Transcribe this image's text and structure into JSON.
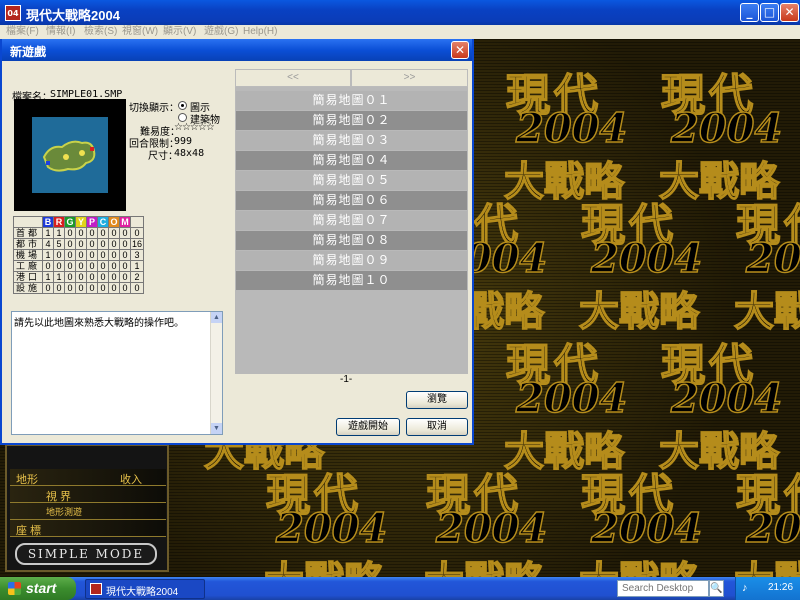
{
  "window": {
    "title": "現代大戰略2004",
    "app_icon_text": "04",
    "minimize": "_",
    "maximize": "□",
    "close": "✕"
  },
  "menu": [
    "檔案(F)",
    "情報(I)",
    "檢索(S)",
    "視窗(W)",
    "顯示(V)",
    "遊戲(G)",
    "Help(H)"
  ],
  "background": {
    "logo_line1": "現代",
    "logo_line2": "2004",
    "logo_line3": "大戰略"
  },
  "side_panel": {
    "rows": [
      "地形",
      "收入",
      "視 界",
      "地形測遊",
      "座 標"
    ],
    "mode_button": "SIMPLE MODE"
  },
  "dialog": {
    "title": "新遊戲",
    "close": "✕",
    "filename_label": "檔案名：",
    "filename": "SIMPLE01.SMP",
    "toggle_label": "切換顯示：",
    "radio_map": "圖示",
    "radio_building": "建築物",
    "difficulty_label": "難易度：",
    "difficulty_stars": "☆☆☆☆☆",
    "turn_limit_label": "回合限制：",
    "turn_limit": "999",
    "size_label": "尺寸：",
    "size": "48x48",
    "stats": {
      "headers": [
        "B",
        "R",
        "G",
        "Y",
        "P",
        "C",
        "O",
        "M"
      ],
      "header_colors": [
        "#1e3ad8",
        "#d81e1e",
        "#1a9a2a",
        "#e0d21a",
        "#c01ec8",
        "#1eaee0",
        "#e08a1e",
        "#e01ea0"
      ],
      "rows": [
        {
          "label": "首都",
          "values": [
            "1",
            "1",
            "0",
            "0",
            "0",
            "0",
            "0",
            "0",
            "0"
          ]
        },
        {
          "label": "都市",
          "values": [
            "4",
            "5",
            "0",
            "0",
            "0",
            "0",
            "0",
            "0",
            "16"
          ]
        },
        {
          "label": "機場",
          "values": [
            "1",
            "0",
            "0",
            "0",
            "0",
            "0",
            "0",
            "0",
            "3"
          ]
        },
        {
          "label": "工廠",
          "values": [
            "0",
            "0",
            "0",
            "0",
            "0",
            "0",
            "0",
            "0",
            "1"
          ]
        },
        {
          "label": "港口",
          "values": [
            "1",
            "1",
            "0",
            "0",
            "0",
            "0",
            "0",
            "0",
            "2"
          ]
        },
        {
          "label": "設施",
          "values": [
            "0",
            "0",
            "0",
            "0",
            "0",
            "0",
            "0",
            "0",
            "0"
          ]
        }
      ]
    },
    "description": "請先以此地圖來熟悉大戰略的操作吧。",
    "pager_prev": "<<",
    "pager_next": ">>",
    "maps": [
      "簡易地圖０１",
      "簡易地圖０２",
      "簡易地圖０３",
      "簡易地圖０４",
      "簡易地圖０５",
      "簡易地圖０６",
      "簡易地圖０７",
      "簡易地圖０８",
      "簡易地圖０９",
      "簡易地圖１０"
    ],
    "page": "-1-",
    "browse_button": "瀏覽",
    "start_button": "遊戲開始",
    "cancel_button": "取消"
  },
  "taskbar": {
    "start": "start",
    "task": "現代大戰略2004",
    "search_placeholder": "Search Desktop",
    "search_go": "🔍",
    "time": "21:26"
  }
}
